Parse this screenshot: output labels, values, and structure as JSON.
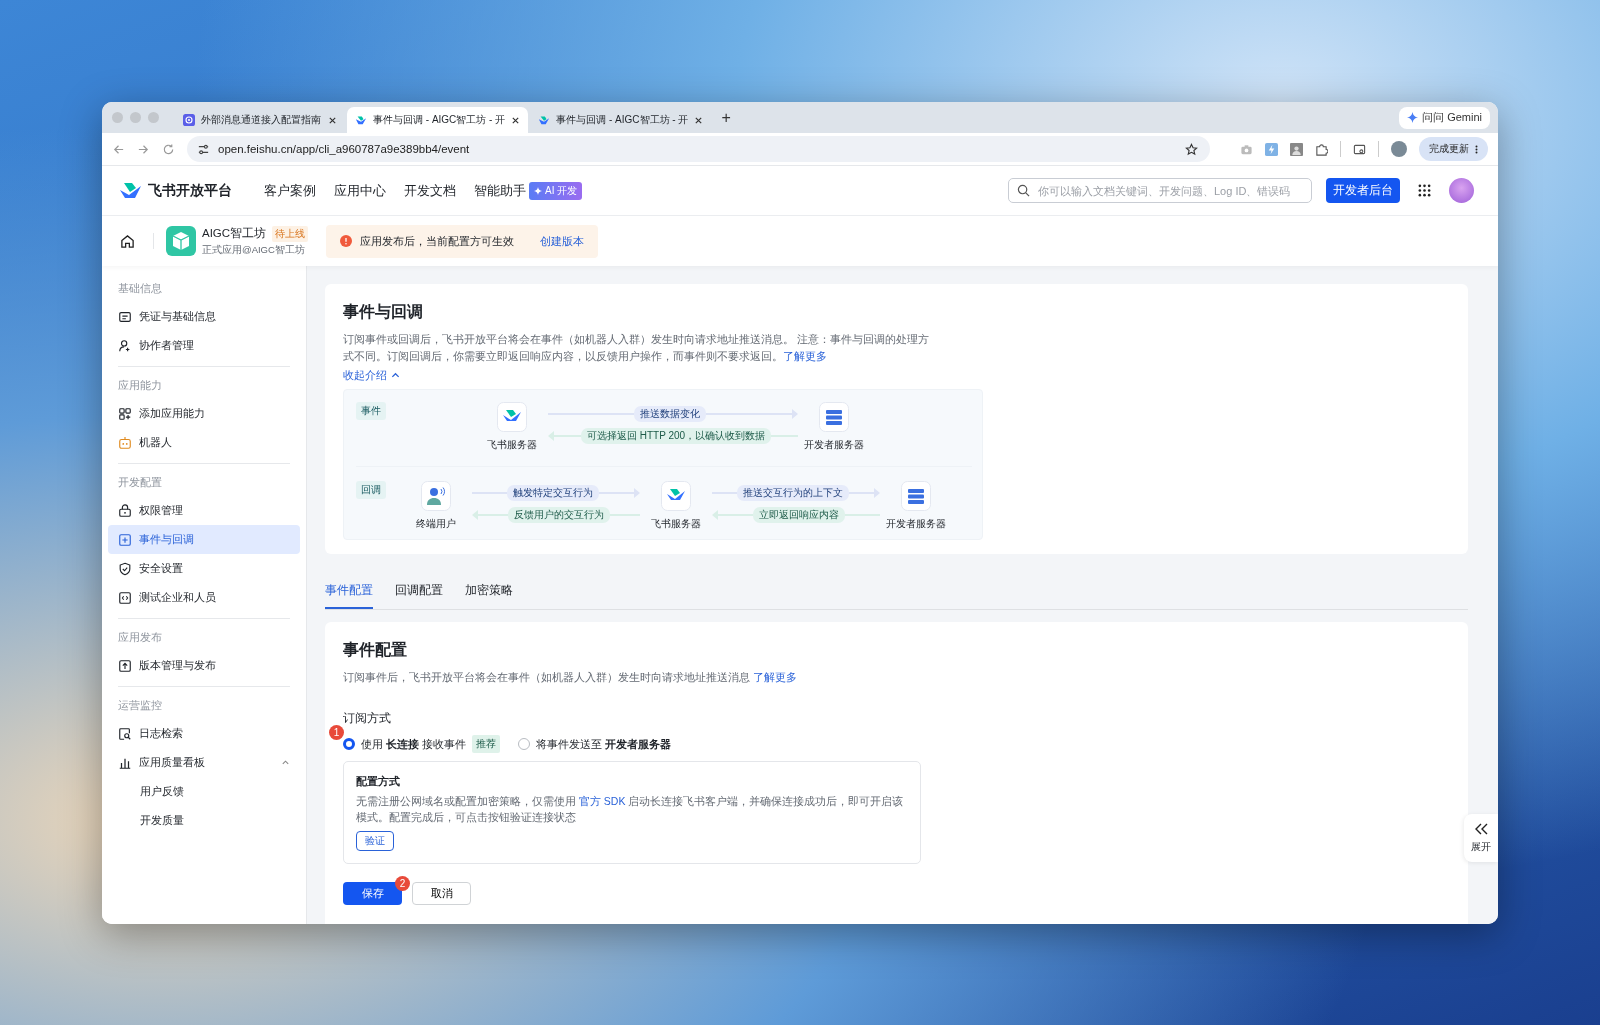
{
  "browser": {
    "tabs": [
      {
        "title": "外部消息通道接入配置指南",
        "selected": false
      },
      {
        "title": "事件与回调 - AIGC智工坊 - 开",
        "selected": true
      },
      {
        "title": "事件与回调 - AIGC智工坊 - 开",
        "selected": false
      }
    ],
    "new_tab": "+",
    "gemini_button": "问问 Gemini",
    "address": "open.feishu.cn/app/cli_a960787a9e389bb4/event",
    "update_button": "完成更新"
  },
  "header": {
    "logo": "飞书开放平台",
    "nav": [
      "客户案例",
      "应用中心",
      "开发文档",
      "智能助手"
    ],
    "ai_badge": "AI 开发",
    "search": {
      "placeholder": "你可以输入文档关键词、开发问题、Log ID、错误码"
    },
    "console_button": "开发者后台"
  },
  "app_bar": {
    "app_name": "AIGC智工坊",
    "status": "待上线",
    "subtitle": "正式应用@AIGC智工坊",
    "notice": "应用发布后，当前配置方可生效",
    "notice_link": "创建版本"
  },
  "sidebar": {
    "sections": [
      {
        "title": "基础信息",
        "items": [
          {
            "label": "凭证与基础信息",
            "selected": false
          },
          {
            "label": "协作者管理",
            "selected": false
          }
        ]
      },
      {
        "title": "应用能力",
        "items": [
          {
            "label": "添加应用能力",
            "selected": false
          },
          {
            "label": "机器人",
            "selected": false
          }
        ]
      },
      {
        "title": "开发配置",
        "items": [
          {
            "label": "权限管理",
            "selected": false
          },
          {
            "label": "事件与回调",
            "selected": true
          },
          {
            "label": "安全设置",
            "selected": false
          },
          {
            "label": "测试企业和人员",
            "selected": false
          }
        ]
      },
      {
        "title": "应用发布",
        "items": [
          {
            "label": "版本管理与发布",
            "selected": false
          }
        ]
      },
      {
        "title": "运营监控",
        "items": [
          {
            "label": "日志检索",
            "selected": false
          },
          {
            "label": "应用质量看板",
            "selected": false,
            "expanded": true,
            "children": [
              {
                "label": "用户反馈",
                "selected": false
              },
              {
                "label": "开发质量",
                "selected": false
              }
            ]
          }
        ]
      }
    ]
  },
  "intro": {
    "title": "事件与回调",
    "description": "订阅事件或回调后，飞书开放平台将会在事件（如机器人入群）发生时向请求地址推送消息。 注意：事件与回调的处理方式不同。订阅回调后，你需要立即返回响应内容，以反馈用户操作，而事件则不要求返回。",
    "link": "了解更多",
    "collapse": "收起介绍",
    "diagram": {
      "event_row": {
        "tag": "事件",
        "source": "飞书服务器",
        "target": "开发者服务器",
        "forward": "推送数据变化",
        "back": "可选择返回 HTTP 200，以确认收到数据"
      },
      "callback_row": {
        "tag": "回调",
        "user": "终端用户",
        "middle": "飞书服务器",
        "target": "开发者服务器",
        "trigger": "触发特定交互行为",
        "feedback": "反馈用户的交互行为",
        "push": "推送交互行为的上下文",
        "respond": "立即返回响应内容"
      }
    }
  },
  "tabs": [
    {
      "label": "事件配置",
      "selected": true
    },
    {
      "label": "回调配置",
      "selected": false
    },
    {
      "label": "加密策略",
      "selected": false
    }
  ],
  "event_config": {
    "title": "事件配置",
    "description": "订阅事件后，飞书开放平台将会在事件（如机器人入群）发生时向请求地址推送消息",
    "link": "了解更多",
    "method_label": "订阅方式",
    "options": [
      {
        "label": "使用 **长连接** 接收事件",
        "tag": "推荐",
        "selected": true
      },
      {
        "label": "将事件发送至 **开发者服务器**",
        "selected": false
      }
    ],
    "config_box": {
      "title": "配置方式",
      "text_before": "无需注册公网域名或配置加密策略，仅需使用 ",
      "link": "官方 SDK",
      "text_after": " 启动长连接飞书客户端，并确保连接成功后，即可开启该模式。配置完成后，可点击按钮验证连接状态",
      "verify_button": "验证"
    },
    "save_button": "保存",
    "cancel_button": "取消",
    "step_badges": [
      "1",
      "2"
    ]
  },
  "expand_panel": "展开"
}
